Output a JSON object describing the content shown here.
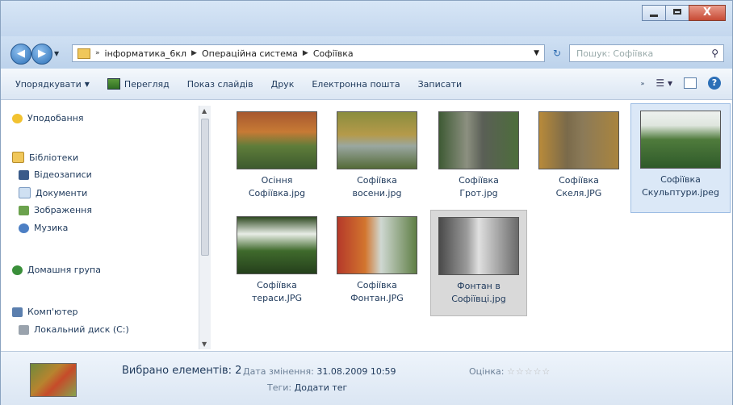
{
  "window": {
    "close_label": "X"
  },
  "address": {
    "crumbs": [
      "інформатика_6кл",
      "Операційна система",
      "Софіївка"
    ],
    "search_placeholder": "Пошук: Софіївка"
  },
  "toolbar": {
    "organize": "Упорядкувати",
    "view": "Перегляд",
    "slideshow": "Показ слайдів",
    "print": "Друк",
    "email": "Електронна пошта",
    "burn": "Записати"
  },
  "nav": {
    "favorites": "Уподобання",
    "libraries": "Бібліотеки",
    "videos": "Відеозаписи",
    "documents": "Документи",
    "pictures": "Зображення",
    "music": "Музика",
    "homegroup": "Домашня група",
    "computer": "Комп'ютер",
    "local_disk": "Локальний диск (C:)"
  },
  "files": [
    {
      "line1": "Осіння",
      "line2": "Софіївка.jpg"
    },
    {
      "line1": "Софіївка",
      "line2": "восени.jpg"
    },
    {
      "line1": "Софіївка",
      "line2": "Грот.jpg"
    },
    {
      "line1": "Софіївка",
      "line2": "Скеля.JPG"
    },
    {
      "line1": "Софіївка",
      "line2": "Скульптури.jpeg"
    },
    {
      "line1": "Софіївка",
      "line2": "тераси.JPG"
    },
    {
      "line1": "Софіївка",
      "line2": "Фонтан.JPG"
    },
    {
      "line1": "Фонтан в",
      "line2": "Софіївці.jpg"
    }
  ],
  "details": {
    "selected": "Вибрано елементів: 2",
    "date_label": "Дата змінення:",
    "date_value": "31.08.2009 10:59",
    "tags_label": "Теги:",
    "tags_value": "Додати тег",
    "rating_label": "Оцінка:",
    "rating_stars": "☆☆☆☆☆"
  }
}
